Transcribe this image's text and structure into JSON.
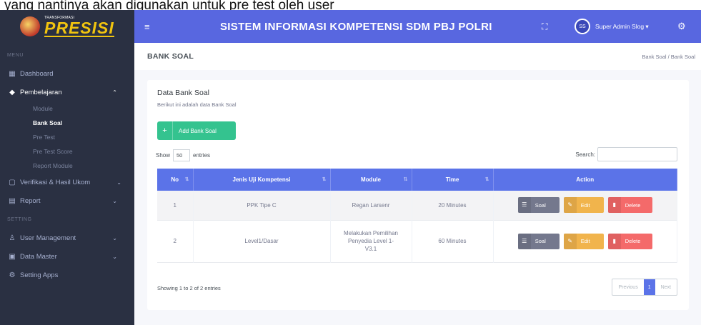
{
  "caption": "yang nantinya akan digunakan untuk pre test oleh user",
  "colors": {
    "sidebar": "#2a3042",
    "topbar": "#5867e0",
    "success": "#34c38f",
    "table_header": "#5b73e8",
    "soal": "#74788d",
    "edit": "#f1b44c",
    "delete": "#f46a6a"
  },
  "logo": {
    "small_text": "TRANSFORMASI",
    "big_text": "PRESISI"
  },
  "header": {
    "system_title": "SISTEM INFORMASI KOMPETENSI SDM PBJ POLRI",
    "avatar_initials": "SS",
    "user_name": "Super Admin Slog ▾"
  },
  "sidebar": {
    "menu_title": "MENU",
    "setting_title": "SETTING",
    "items": [
      {
        "label": "Dashboard",
        "icon": "dashboard-icon"
      },
      {
        "label": "Pembelajaran",
        "icon": "graduation-cap-icon"
      },
      {
        "label": "Verifikasi & Hasil Ukom",
        "icon": "document-icon"
      },
      {
        "label": "Report",
        "icon": "file-icon"
      },
      {
        "label": "User Management",
        "icon": "user-icon"
      },
      {
        "label": "Data Master",
        "icon": "database-icon"
      },
      {
        "label": "Setting Apps",
        "icon": "gear-icon"
      }
    ],
    "sub_items": [
      "Module",
      "Bank Soal",
      "Pre Test",
      "Pre Test Score",
      "Report Module"
    ]
  },
  "page": {
    "title": "BANK SOAL",
    "breadcrumb": "Bank Soal  /  Bank Soal"
  },
  "card": {
    "title": "Data Bank Soal",
    "subtitle": "Berikut ini adalah data Bank Soal",
    "add_button": "Add Bank Soal",
    "show_label": "Show",
    "show_value": "50",
    "entries_label": "entries",
    "search_label": "Search:"
  },
  "table": {
    "headers": [
      "No",
      "Jenis Uji Kompetensi",
      "Module",
      "Time",
      "Action"
    ],
    "rows": [
      {
        "no": "1",
        "jenis": "PPK Tipe C",
        "module": "Regan Larsenr",
        "time": "20 Minutes"
      },
      {
        "no": "2",
        "jenis": "Level1/Dasar",
        "module": "Melakukan Pemilihan Penyedia Level 1-V3.1",
        "time": "60 Minutes"
      }
    ],
    "actions": {
      "soal": "Soal",
      "edit": "Edit",
      "delete": "Delete"
    }
  },
  "footer": {
    "info": "Showing 1 to 2 of 2 entries",
    "prev": "Previous",
    "page": "1",
    "next": "Next"
  }
}
